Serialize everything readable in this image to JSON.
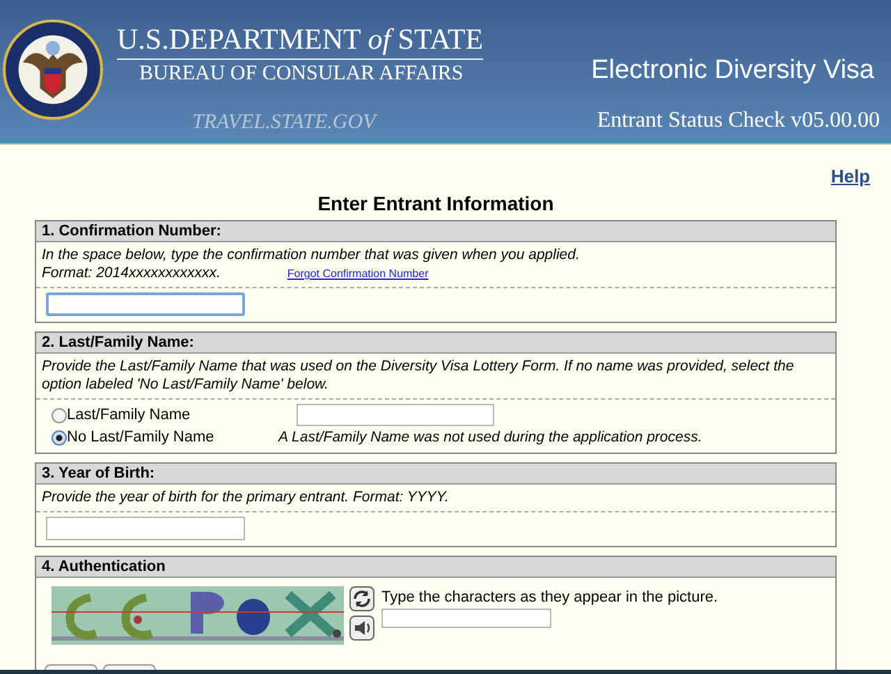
{
  "header": {
    "department": "U.S.DEPARTMENT *of* STATE",
    "bureau": "BUREAU OF CONSULAR AFFAIRS",
    "site": "TRAVEL.STATE.GOV",
    "app_title": "Electronic Diversity Visa",
    "app_subtitle": "Entrant Status Check v05.00.00"
  },
  "help_link": "Help",
  "heading": "Enter Entrant Information",
  "sections": [
    {
      "kind": "confirmation",
      "title": "1. Confirmation Number:",
      "instructions": "In the space below, type the confirmation number that was given when you applied.",
      "format": "Format: 2014xxxxxxxxxxxx.",
      "link": "Forgot Confirmation Number",
      "field": {
        "focused": true
      }
    },
    {
      "kind": "name",
      "title": "2. Last/Family Name:",
      "instructions": "Provide the Last/Family Name that was used on the Diversity Visa Lottery Form. If no name was provided, select the option labeled 'No Last/Family Name' below.",
      "options": [
        {
          "label": "Last/Family Name",
          "selected": false,
          "kind": "field"
        },
        {
          "label": "No Last/Family Name",
          "selected": true,
          "kind": "note",
          "note": "A Last/Family Name was not used during the application process."
        }
      ]
    },
    {
      "kind": "year",
      "title": "3. Year of Birth:",
      "instructions": "Provide the year of birth for the primary entrant. Format: YYYY.",
      "field": {
        "focused": false
      }
    },
    {
      "kind": "captcha",
      "title": "4. Authentication",
      "prompt": "Type the characters as they appear in the picture."
    }
  ]
}
